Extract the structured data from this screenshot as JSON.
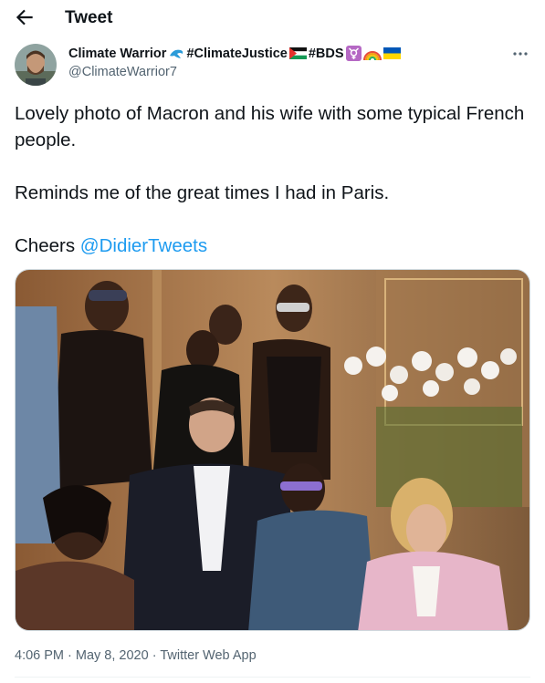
{
  "header": {
    "title": "Tweet",
    "back_icon": "arrow-left-icon"
  },
  "author": {
    "name": "Climate Warrior",
    "hashtag_climate": "#ClimateJustice",
    "hashtag_bds": "#BDS",
    "handle": "@ClimateWarrior7",
    "emojis": [
      "dolphin-emoji",
      "palestine-flag-emoji",
      "transgender-symbol-emoji",
      "rainbow-emoji",
      "ukraine-flag-emoji"
    ]
  },
  "tweet": {
    "line1": "Lovely photo of Macron and his wife with some typical French people.",
    "line2": "Reminds me of the great times I had in Paris.",
    "cheers": "Cheers ",
    "mention": "@DidierTweets"
  },
  "meta": {
    "time": "4:06 PM",
    "sep1": " · ",
    "date": "May 8, 2020",
    "sep2": " · ",
    "source": "Twitter Web App"
  },
  "colors": {
    "link": "#1d9bf0",
    "secondary": "#536471",
    "text": "#0f1419"
  }
}
